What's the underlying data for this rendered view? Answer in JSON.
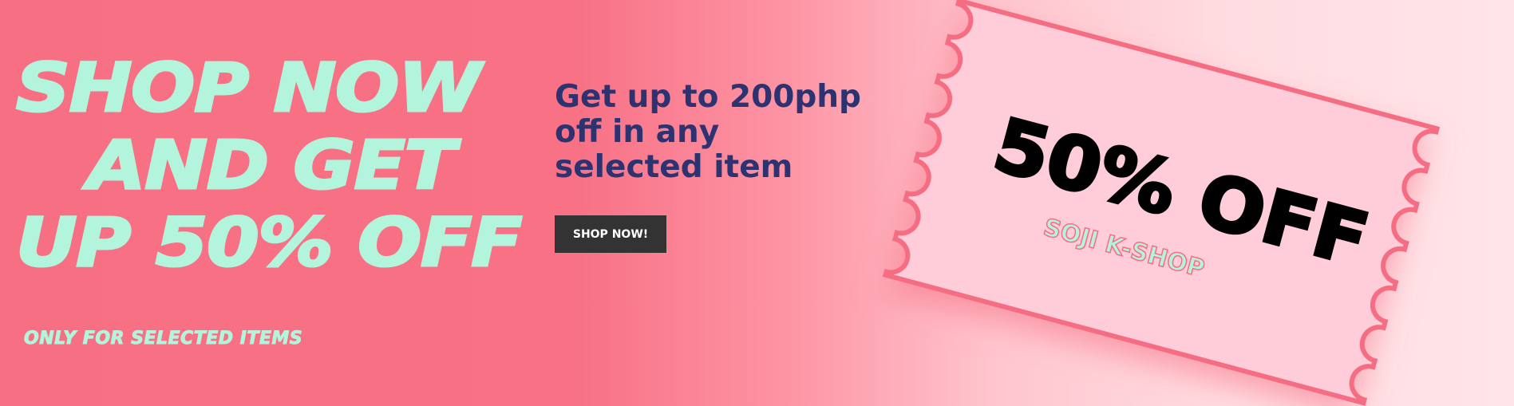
{
  "banner": {
    "headline_lines": [
      "SHOP NOW",
      "AND GET",
      "UP 50% OFF"
    ],
    "subheadline": "ONLY FOR SELECTED ITEMS",
    "offer_lines": [
      "Get up to 200php",
      "off in any",
      "selected item"
    ],
    "cta_label": "SHOP NOW!"
  },
  "ticket": {
    "discount": "50% OFF",
    "brand": "SOJI K-SHOP"
  },
  "colors": {
    "mint": "#b3f5dc",
    "navy": "#2d3270",
    "pink": "#f76f83",
    "ticket_fill": "#ffcdd9",
    "button": "#333333"
  }
}
